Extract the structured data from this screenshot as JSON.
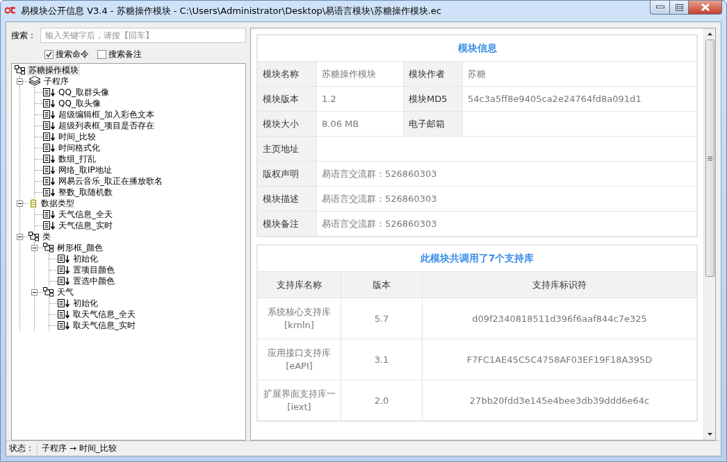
{
  "window": {
    "title": "易模块公开信息 V3.4 - 苏糖操作模块 - C:\\Users\\Administrator\\Desktop\\易语言模块\\苏糖操作模块.ec"
  },
  "search": {
    "label": "搜索：",
    "placeholder": "输入关键字后，请按【回车】"
  },
  "options": [
    {
      "label": "搜索命令",
      "checked": true
    },
    {
      "label": "搜索备注",
      "checked": false
    }
  ],
  "tree": [
    {
      "label": "苏糖操作模块",
      "kind": "class",
      "selected": true,
      "children": [
        {
          "label": "子程序",
          "kind": "sub",
          "selected": false,
          "expanded": true,
          "children": [
            {
              "label": "QQ_取群头像",
              "kind": "func",
              "selected": false
            },
            {
              "label": "QQ_取头像",
              "kind": "func",
              "selected": false
            },
            {
              "label": "超级编辑框_加入彩色文本",
              "kind": "func",
              "selected": false
            },
            {
              "label": "超级列表框_项目是否存在",
              "kind": "func",
              "selected": false
            },
            {
              "label": "时间_比较",
              "kind": "func",
              "selected": false
            },
            {
              "label": "时间格式化",
              "kind": "func",
              "selected": false
            },
            {
              "label": "数组_打乱",
              "kind": "func",
              "selected": false
            },
            {
              "label": "网络_取IP地址",
              "kind": "func",
              "selected": false
            },
            {
              "label": "网易云音乐_取正在播放歌名",
              "kind": "func",
              "selected": false
            },
            {
              "label": "整数_取随机数",
              "kind": "func",
              "selected": false
            }
          ]
        },
        {
          "label": "数据类型",
          "kind": "type",
          "selected": false,
          "expanded": true,
          "children": [
            {
              "label": "天气信息_全天",
              "kind": "func",
              "selected": false
            },
            {
              "label": "天气信息_实时",
              "kind": "func",
              "selected": false
            }
          ]
        },
        {
          "label": "类",
          "kind": "class",
          "selected": false,
          "expanded": true,
          "children": [
            {
              "label": "树形框_颜色",
              "kind": "class",
              "selected": false,
              "expanded": true,
              "children": [
                {
                  "label": "初始化",
                  "kind": "func",
                  "selected": false
                },
                {
                  "label": "置项目颜色",
                  "kind": "func",
                  "selected": false
                },
                {
                  "label": "置选中颜色",
                  "kind": "func",
                  "selected": false
                }
              ]
            },
            {
              "label": "天气",
              "kind": "class",
              "selected": false,
              "expanded": true,
              "children": [
                {
                  "label": "初始化",
                  "kind": "func",
                  "selected": false
                },
                {
                  "label": "取天气信息_全天",
                  "kind": "func",
                  "selected": false
                },
                {
                  "label": "取天气信息_实时",
                  "kind": "func",
                  "selected": false
                }
              ]
            }
          ]
        }
      ]
    }
  ],
  "info": {
    "title": "模块信息",
    "rows": [
      [
        {
          "label": "模块名称",
          "value": "苏糖操作模块"
        },
        {
          "label": "模块作者",
          "value": "苏糖"
        }
      ],
      [
        {
          "label": "模块版本",
          "value": "1.2"
        },
        {
          "label": "模块MD5",
          "value": "54c3a5ff8e9405ca2e24764fd8a091d1"
        }
      ],
      [
        {
          "label": "模块大小",
          "value": "8.06 MB"
        },
        {
          "label": "电子邮箱"
        }
      ],
      [
        {
          "label": "主页地址"
        }
      ],
      [
        {
          "label": "版权声明",
          "value": "易语言交流群：526860303"
        }
      ],
      [
        {
          "label": "模块描述",
          "value": "易语言交流群：526860303"
        }
      ],
      [
        {
          "label": "模块备注",
          "value": "易语言交流群：526860303"
        }
      ]
    ]
  },
  "libraries": {
    "title": "此模块共调用了7个支持库",
    "columns": [
      "支持库名称",
      "版本",
      "支持库标识符"
    ],
    "rows": [
      {
        "name": "系统核心支持库",
        "code": "[krnln]",
        "version": "5.7",
        "identifier": "d09f2340818511d396f6aaf844c7e325"
      },
      {
        "name": "应用接口支持库",
        "code": "[eAPI]",
        "version": "3.1",
        "identifier": "F7FC1AE45C5C4758AF03EF19F18A395D"
      },
      {
        "name": "扩展界面支持库一",
        "code": "[iext]",
        "version": "2.0",
        "identifier": "27bb20fdd3e145e4bee3db39ddd6e64c"
      }
    ]
  },
  "status_bar": {
    "label": "状态：",
    "text": "子程序 → 时间_比较"
  }
}
